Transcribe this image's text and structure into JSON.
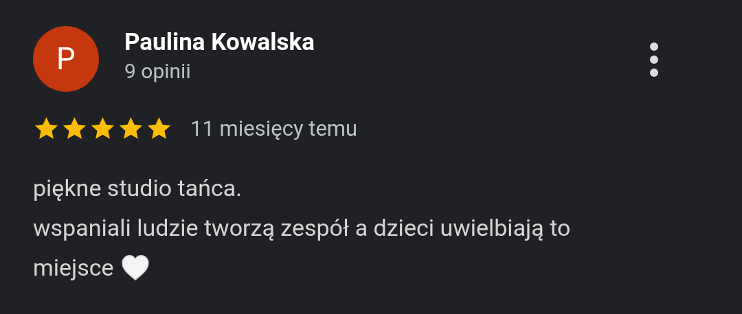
{
  "review": {
    "avatar_letter": "P",
    "author": "Paulina Kowalska",
    "review_count": "9 opinii",
    "stars": 5,
    "time": "11 miesięcy temu",
    "lines": [
      "piękne studio tańca.",
      "wspaniali ludzie tworzą zespół a dzieci uwielbiają to",
      "miejsce"
    ]
  }
}
